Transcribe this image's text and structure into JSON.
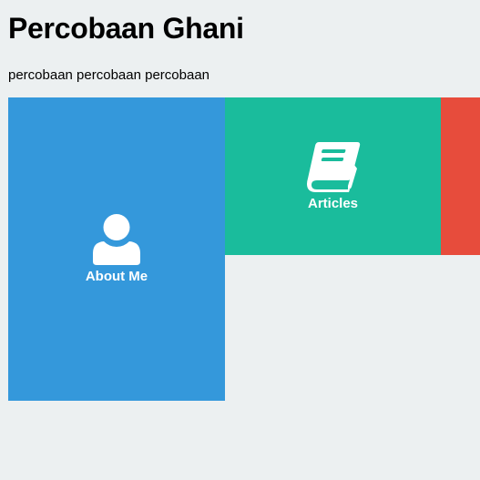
{
  "header": {
    "title": "Percobaan Ghani",
    "subtitle": "percobaan percobaan percobaan"
  },
  "tiles": [
    {
      "label": "About Me",
      "icon": "user-icon",
      "color": "#3498db"
    },
    {
      "label": "Articles",
      "icon": "book-icon",
      "color": "#1abc9c"
    },
    {
      "label": "",
      "icon": "",
      "color": "#e74c3c"
    }
  ],
  "colors": {
    "background": "#ecf0f1",
    "text": "#000000",
    "tile_text": "#ffffff"
  }
}
